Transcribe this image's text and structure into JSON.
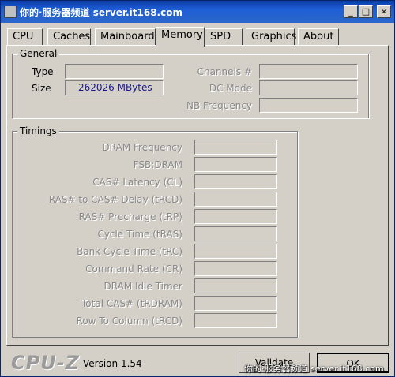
{
  "window": {
    "title": "你的·服务器频道 server.it168.com",
    "minimize_glyph": "_",
    "maximize_glyph": "□",
    "close_glyph": "×"
  },
  "tabs": [
    {
      "label": "CPU",
      "active": false
    },
    {
      "label": "Caches",
      "active": false
    },
    {
      "label": "Mainboard",
      "active": false
    },
    {
      "label": "Memory",
      "active": true
    },
    {
      "label": "SPD",
      "active": false
    },
    {
      "label": "Graphics",
      "active": false
    },
    {
      "label": "About",
      "active": false
    }
  ],
  "general": {
    "legend": "General",
    "type_label": "Type",
    "type_value": "",
    "size_label": "Size",
    "size_value": "262026 MBytes",
    "channels_label": "Channels #",
    "channels_value": "",
    "dc_mode_label": "DC Mode",
    "dc_mode_value": "",
    "nb_frequency_label": "NB Frequency",
    "nb_frequency_value": ""
  },
  "timings": {
    "legend": "Timings",
    "rows": [
      {
        "label": "DRAM Frequency",
        "value": ""
      },
      {
        "label": "FSB:DRAM",
        "value": ""
      },
      {
        "label": "CAS# Latency (CL)",
        "value": ""
      },
      {
        "label": "RAS# to CAS# Delay (tRCD)",
        "value": ""
      },
      {
        "label": "RAS# Precharge (tRP)",
        "value": ""
      },
      {
        "label": "Cycle Time (tRAS)",
        "value": ""
      },
      {
        "label": "Bank Cycle Time (tRC)",
        "value": ""
      },
      {
        "label": "Command Rate (CR)",
        "value": ""
      },
      {
        "label": "DRAM Idle Timer",
        "value": ""
      },
      {
        "label": "Total CAS# (tRDRAM)",
        "value": ""
      },
      {
        "label": "Row To Column (tRCD)",
        "value": ""
      }
    ]
  },
  "footer": {
    "logo": "CPU-Z",
    "version": "Version 1.54",
    "validate_label": "Validate",
    "ok_label": "OK",
    "watermark": "你的·服务器频道 server.it168.com"
  }
}
